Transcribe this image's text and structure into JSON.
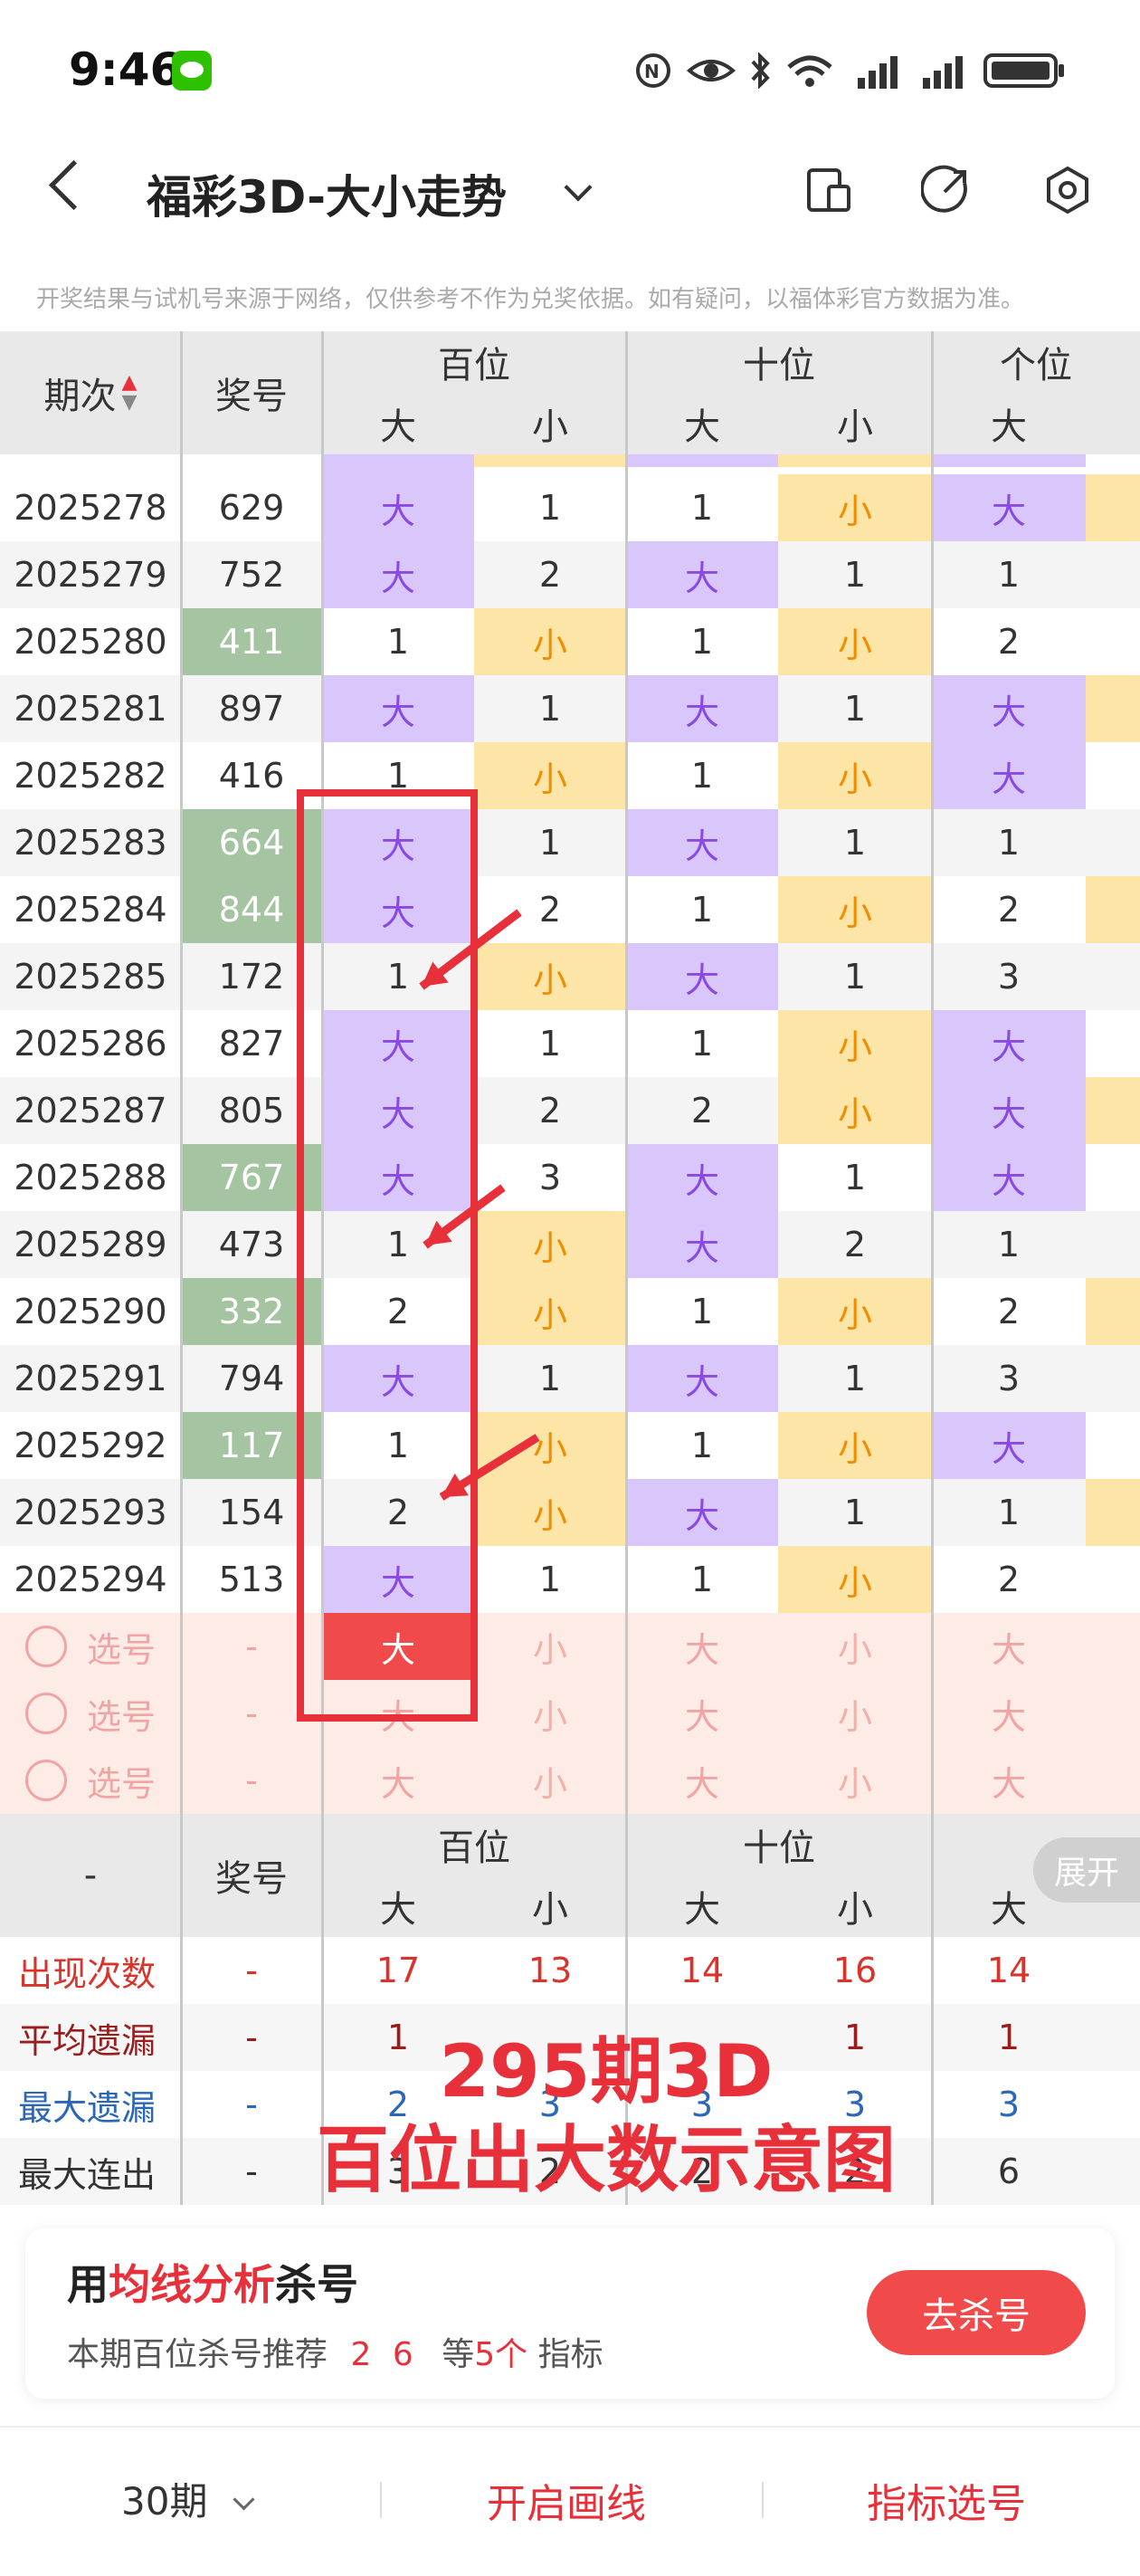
{
  "status_bar": {
    "time": "9:46"
  },
  "header": {
    "title": "福彩3D-大小走势",
    "notice": "开奖结果与试机号来源于网络，仅供参考不作为兑奖依据。如有疑问，以福体彩官方数据为准。"
  },
  "table_header": {
    "period": "期次",
    "number": "奖号",
    "groups": [
      "百位",
      "十位",
      "个位"
    ],
    "sub": [
      "大",
      "小",
      "大",
      "小",
      "大"
    ]
  },
  "rows": [
    {
      "period": "2025278",
      "number": "629",
      "hl": false,
      "cells": [
        "大",
        "1",
        "1",
        "小",
        "大"
      ]
    },
    {
      "period": "2025279",
      "number": "752",
      "hl": false,
      "cells": [
        "大",
        "2",
        "大",
        "1",
        "1"
      ]
    },
    {
      "period": "2025280",
      "number": "411",
      "hl": true,
      "cells": [
        "1",
        "小",
        "1",
        "小",
        "2"
      ]
    },
    {
      "period": "2025281",
      "number": "897",
      "hl": false,
      "cells": [
        "大",
        "1",
        "大",
        "1",
        "大"
      ]
    },
    {
      "period": "2025282",
      "number": "416",
      "hl": false,
      "cells": [
        "1",
        "小",
        "1",
        "小",
        "大"
      ]
    },
    {
      "period": "2025283",
      "number": "664",
      "hl": true,
      "cells": [
        "大",
        "1",
        "大",
        "1",
        "1"
      ]
    },
    {
      "period": "2025284",
      "number": "844",
      "hl": true,
      "cells": [
        "大",
        "2",
        "1",
        "小",
        "2"
      ]
    },
    {
      "period": "2025285",
      "number": "172",
      "hl": false,
      "cells": [
        "1",
        "小",
        "大",
        "1",
        "3"
      ]
    },
    {
      "period": "2025286",
      "number": "827",
      "hl": false,
      "cells": [
        "大",
        "1",
        "1",
        "小",
        "大"
      ]
    },
    {
      "period": "2025287",
      "number": "805",
      "hl": false,
      "cells": [
        "大",
        "2",
        "2",
        "小",
        "大"
      ]
    },
    {
      "period": "2025288",
      "number": "767",
      "hl": true,
      "cells": [
        "大",
        "3",
        "大",
        "1",
        "大"
      ]
    },
    {
      "period": "2025289",
      "number": "473",
      "hl": false,
      "cells": [
        "1",
        "小",
        "大",
        "2",
        "1"
      ]
    },
    {
      "period": "2025290",
      "number": "332",
      "hl": true,
      "cells": [
        "2",
        "小",
        "1",
        "小",
        "2"
      ]
    },
    {
      "period": "2025291",
      "number": "794",
      "hl": false,
      "cells": [
        "大",
        "1",
        "大",
        "1",
        "3"
      ]
    },
    {
      "period": "2025292",
      "number": "117",
      "hl": true,
      "cells": [
        "1",
        "小",
        "1",
        "小",
        "大"
      ]
    },
    {
      "period": "2025293",
      "number": "154",
      "hl": false,
      "cells": [
        "2",
        "小",
        "大",
        "1",
        "1"
      ]
    },
    {
      "period": "2025294",
      "number": "513",
      "hl": false,
      "cells": [
        "大",
        "1",
        "1",
        "小",
        "2"
      ]
    }
  ],
  "pick_rows": [
    {
      "label": "选号",
      "dash": "-",
      "cells": [
        "大",
        "小",
        "大",
        "小",
        "大"
      ],
      "selected": 0
    },
    {
      "label": "选号",
      "dash": "-",
      "cells": [
        "大",
        "小",
        "大",
        "小",
        "大"
      ],
      "selected": -1
    },
    {
      "label": "选号",
      "dash": "-",
      "cells": [
        "大",
        "小",
        "大",
        "小",
        "大"
      ],
      "selected": -1
    }
  ],
  "stats_header": {
    "dash": "-",
    "number": "奖号",
    "groups": [
      "百位",
      "十位"
    ],
    "sub": [
      "大",
      "小",
      "大",
      "小",
      "大"
    ],
    "expand": "展开"
  },
  "stats": [
    {
      "label": "出现次数",
      "dash": "-",
      "values": [
        "17",
        "13",
        "14",
        "16",
        "14"
      ],
      "color": "red"
    },
    {
      "label": "平均遗漏",
      "dash": "-",
      "values": [
        "1",
        "",
        "",
        "1",
        "1"
      ],
      "color": "darkred"
    },
    {
      "label": "最大遗漏",
      "dash": "-",
      "values": [
        "2",
        "3",
        "3",
        "3",
        "3"
      ],
      "color": "blue"
    },
    {
      "label": "最大连出",
      "dash": "-",
      "values": [
        "3",
        "2",
        "2",
        "2",
        "6"
      ],
      "color": "dark"
    }
  ],
  "overlay": {
    "line1": "295期3D",
    "line2": "百位出大数示意图"
  },
  "promo": {
    "prefix": "用",
    "highlight": "均线分析",
    "suffix": "杀号",
    "line2_prefix": "本期百位杀号推荐",
    "nums": "2 6",
    "line2_mid": "等",
    "count": "5个",
    "line2_suffix": "指标",
    "button": "去杀号"
  },
  "bottom": {
    "periods": "30期",
    "draw": "开启画线",
    "pick": "指标选号"
  },
  "colors": {
    "accent_red": "#f04a4a",
    "big_bg": "#d9c7fb",
    "small_bg": "#fde5a7",
    "ball_hl": "#a5c4a1"
  }
}
